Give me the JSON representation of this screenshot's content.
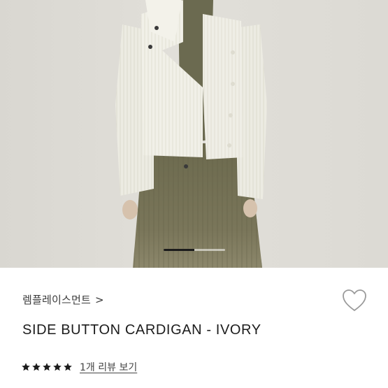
{
  "product": {
    "brand": "렘플레이스먼트",
    "brand_chevron": ">",
    "title": "SIDE BUTTON CARDIGAN - IVORY",
    "rating": 5,
    "review_link": "1개 리뷰 보기",
    "wishlist_icon": "heart-outline-icon",
    "rating_icon": "star-icon"
  },
  "gallery": {
    "progress": 0.5
  },
  "colors": {
    "text": "#1c1c1c",
    "star": "#1c1c1c",
    "heart": "#9a9a9a"
  }
}
